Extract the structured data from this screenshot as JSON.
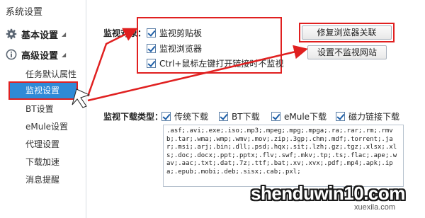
{
  "window": {
    "title": "系统设置"
  },
  "sidebar": {
    "groups": [
      {
        "label": "基本设置",
        "icon": "gear-icon"
      },
      {
        "label": "高级设置",
        "icon": "info-icon"
      }
    ],
    "items": [
      {
        "label": "任务默认属性"
      },
      {
        "label": "监视设置"
      },
      {
        "label": "BT设置"
      },
      {
        "label": "eMule设置"
      },
      {
        "label": "代理设置"
      },
      {
        "label": "下载加速"
      },
      {
        "label": "消息提醒"
      }
    ]
  },
  "monitor": {
    "label": "监视对象：",
    "options": [
      {
        "label": "监视剪贴板",
        "checked": true
      },
      {
        "label": "监视浏览器",
        "checked": true
      },
      {
        "label": "Ctrl+鼠标左键打开链接时不监视",
        "checked": true
      }
    ],
    "buttons": {
      "repair": "修复浏览器关联",
      "no_monitor_sites": "设置不监视网站"
    }
  },
  "download_types": {
    "label": "监视下载类型：",
    "options": [
      {
        "label": "传统下载",
        "checked": true
      },
      {
        "label": "BT下载",
        "checked": true
      },
      {
        "label": "eMule下载",
        "checked": true
      },
      {
        "label": "磁力链接下载",
        "checked": true
      }
    ],
    "extensions": ".asf;.avi;.exe;.iso;.mp3;.mpeg;.mpg;.mpga;.ra;.rar;.rm;.rmvb;.tar;.wma;.wmp;.wmv;.mov;.zip;.3gp;.chm;.mdf;.torrent;.jar;.msi;.arj;.bin;.dll;.psd;.hqx;.sit;.lzh;.gz;.tgz;.xlsx;.xls;.doc;.docx;.ppt;.pptx;.flv;.swf;.mkv;.tp;.ts;.flac;.ape;.wav;.aac;.txt;.dat;.7z;.ttf;.bat;.xv;.xvx;.pdf;.mp4;.apk;.ipa;.epub;.mobi;.deb;.sisx;.cab;.pxl;"
  },
  "watermark": {
    "main": "shenduwin10.com",
    "sub": "xuexila.com"
  },
  "colors": {
    "highlight": "#2f8ad7",
    "annotation_red": "#e02020"
  }
}
